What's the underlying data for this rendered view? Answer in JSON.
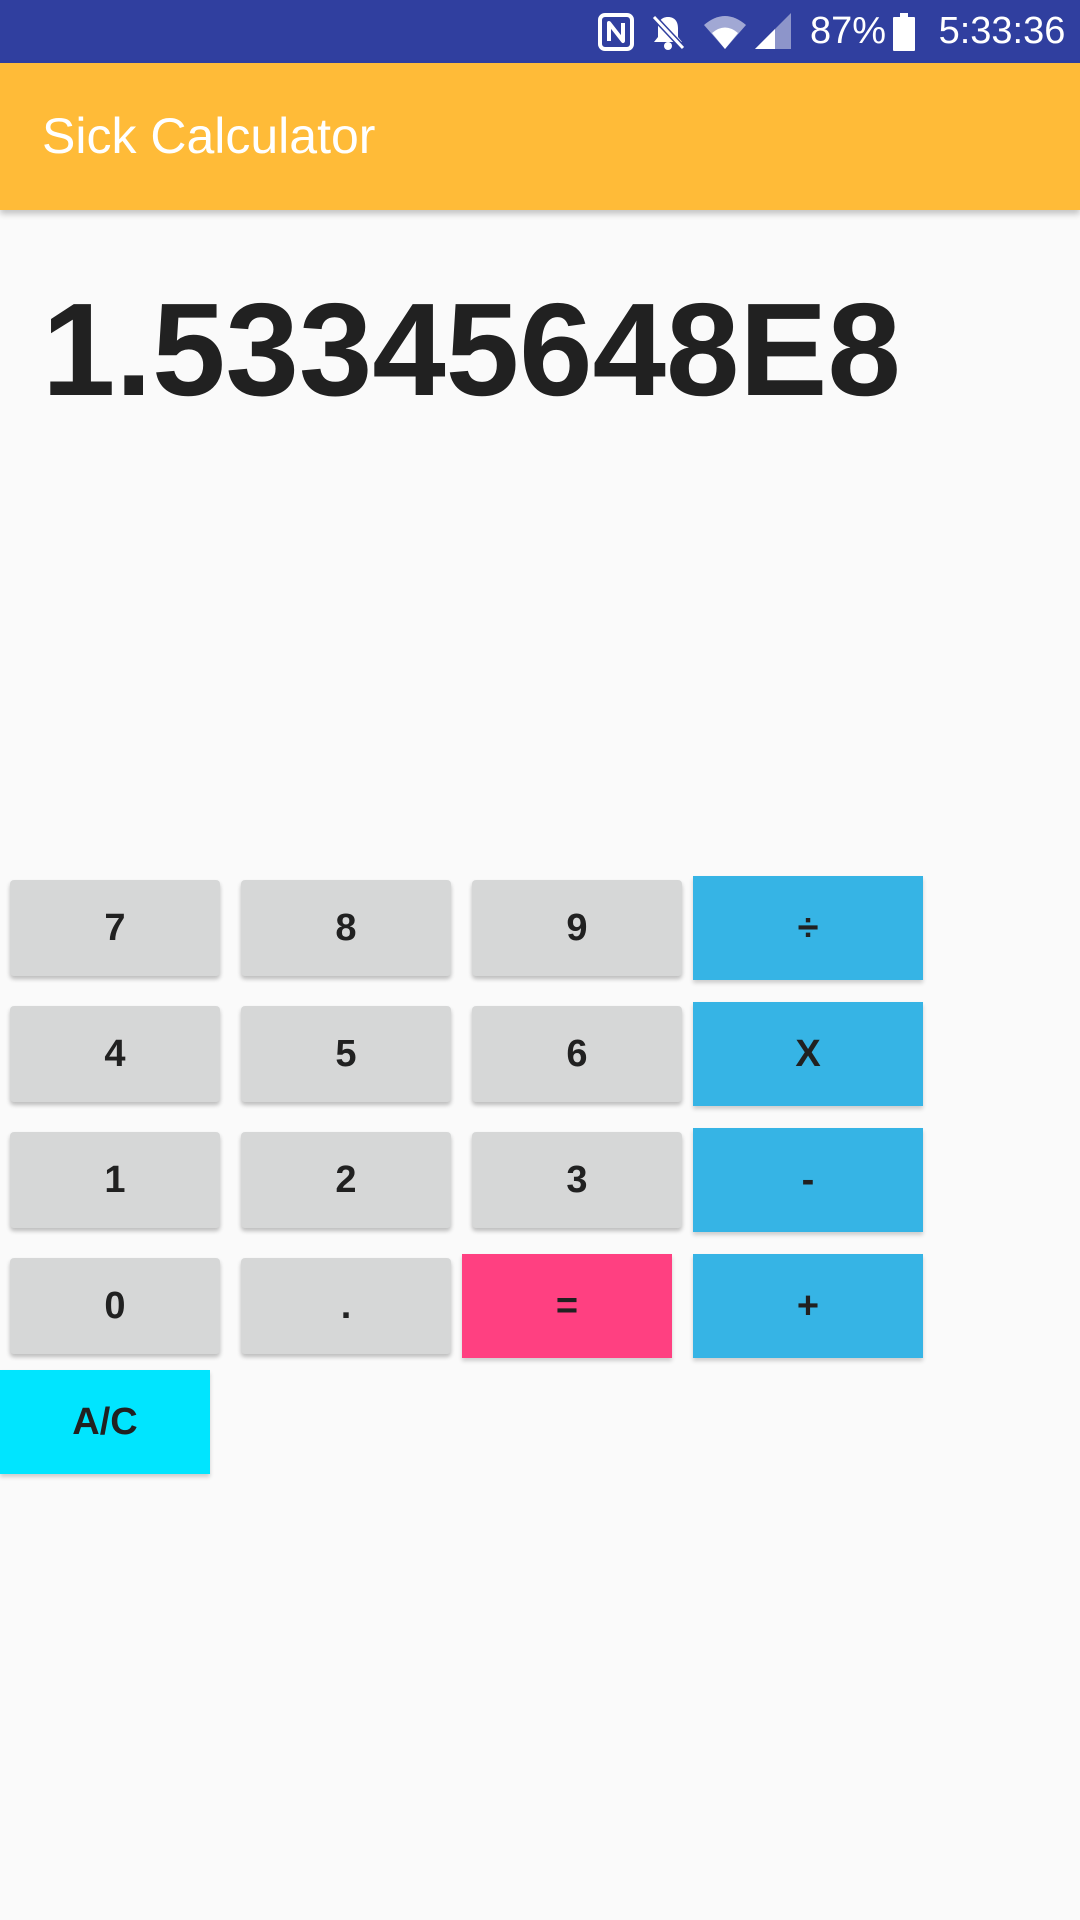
{
  "status_bar": {
    "icons": [
      "nfc-icon",
      "notifications-off-icon",
      "wifi-icon",
      "cell-signal-icon",
      "battery-icon"
    ],
    "battery_percent": "87%",
    "time": "5:33:36",
    "colors": {
      "background": "#303f9f",
      "foreground": "#ffffff"
    }
  },
  "app_bar": {
    "title": "Sick Calculator",
    "color": "#ffbb38"
  },
  "display": {
    "value": "1.53345648E8"
  },
  "keypad": {
    "seven": "7",
    "eight": "8",
    "nine": "9",
    "divide": "÷",
    "four": "4",
    "five": "5",
    "six": "6",
    "multiply": "X",
    "one": "1",
    "two": "2",
    "three": "3",
    "subtract": "-",
    "zero": "0",
    "decimal": ".",
    "equals": "=",
    "add": "+",
    "clear": "A/C",
    "colors": {
      "digit": "#d6d7d7",
      "operator": "#36b4e5",
      "equals": "#ff4081",
      "clear": "#00e5ff"
    }
  }
}
